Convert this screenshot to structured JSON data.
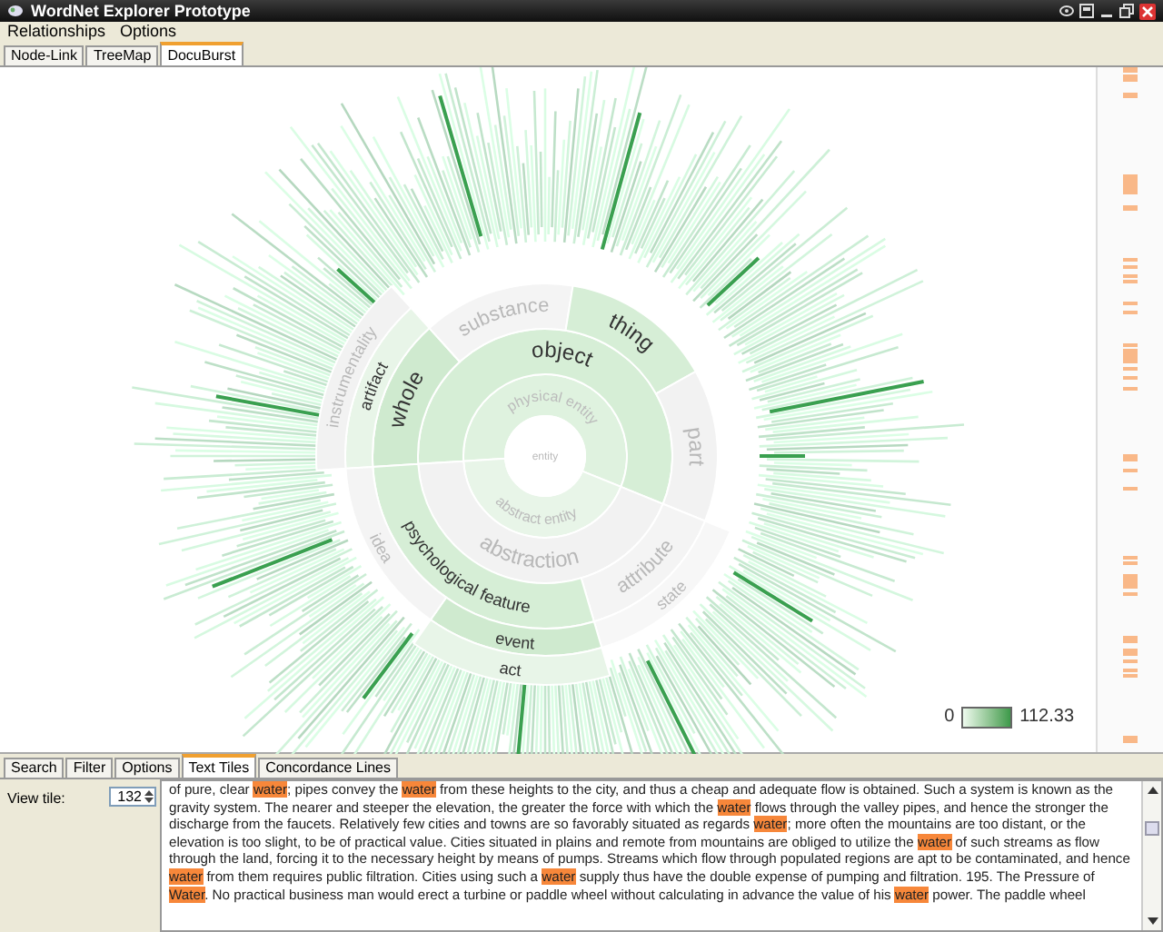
{
  "window": {
    "title": "WordNet Explorer Prototype"
  },
  "menu": [
    "Relationships",
    "Options"
  ],
  "view_tabs": [
    {
      "label": "Node-Link",
      "selected": false
    },
    {
      "label": "TreeMap",
      "selected": false
    },
    {
      "label": "DocuBurst",
      "selected": true
    }
  ],
  "sunburst": {
    "root": {
      "label": "entity",
      "children": [
        {
          "label": "physical entity",
          "children": [
            {
              "label": "object",
              "children": [
                {
                  "label": "whole",
                  "children": [
                    {
                      "label": "artifact",
                      "children": [
                        {
                          "label": "instrumentality"
                        }
                      ]
                    }
                  ]
                },
                {
                  "label": "substance"
                },
                {
                  "label": "thing"
                },
                {
                  "label": "part"
                }
              ]
            }
          ]
        },
        {
          "label": "abstract entity",
          "children": [
            {
              "label": "abstraction",
              "children": [
                {
                  "label": "psychological feature",
                  "children": [
                    {
                      "label": "idea"
                    },
                    {
                      "label": "event",
                      "children": [
                        {
                          "label": "act"
                        }
                      ]
                    }
                  ]
                },
                {
                  "label": "attribute",
                  "children": [
                    {
                      "label": "state"
                    }
                  ]
                }
              ]
            }
          ]
        }
      ]
    }
  },
  "legend": {
    "min": "0",
    "max": "112.33"
  },
  "panel_tabs": [
    {
      "label": "Search",
      "selected": false
    },
    {
      "label": "Filter",
      "selected": false
    },
    {
      "label": "Options",
      "selected": false
    },
    {
      "label": "Text Tiles",
      "selected": true
    },
    {
      "label": "Concordance Lines",
      "selected": false
    }
  ],
  "view_tile": {
    "label": "View tile:",
    "value": "132"
  },
  "text_tile": [
    {
      "text": "of pure, clear ",
      "highlight": false
    },
    {
      "text": "water",
      "highlight": true
    },
    {
      "text": "; pipes convey the ",
      "highlight": false
    },
    {
      "text": "water",
      "highlight": true
    },
    {
      "text": " from these heights to the city, and thus a cheap and adequate flow is obtained. Such a system is known as the gravity system. The nearer and steeper the elevation, the greater the force with which the ",
      "highlight": false
    },
    {
      "text": "water",
      "highlight": true
    },
    {
      "text": " flows through the valley pipes, and hence the stronger the discharge from the faucets. Relatively few cities and towns are so favorably situated as regards ",
      "highlight": false
    },
    {
      "text": "water",
      "highlight": true
    },
    {
      "text": "; more often the mountains are too distant, or the elevation is too slight, to be of practical value. Cities situated in plains and remote from mountains are obliged to utilize the ",
      "highlight": false
    },
    {
      "text": "water",
      "highlight": true
    },
    {
      "text": " of such streams as flow through the land, forcing it to the necessary height by means of pumps. Streams which flow through populated regions are apt to be contaminated, and hence ",
      "highlight": false
    },
    {
      "text": "water",
      "highlight": true
    },
    {
      "text": " from them requires public filtration. Cities using such a ",
      "highlight": false
    },
    {
      "text": "water",
      "highlight": true
    },
    {
      "text": " supply thus have the double expense of pumping and filtration. 195. The Pressure of ",
      "highlight": false
    },
    {
      "text": "Water",
      "highlight": true
    },
    {
      "text": ". No practical business man would erect a turbine or paddle wheel without calculating in advance the value of his ",
      "highlight": false
    },
    {
      "text": "water",
      "highlight": true
    },
    {
      "text": " power. The paddle wheel",
      "highlight": false
    }
  ]
}
